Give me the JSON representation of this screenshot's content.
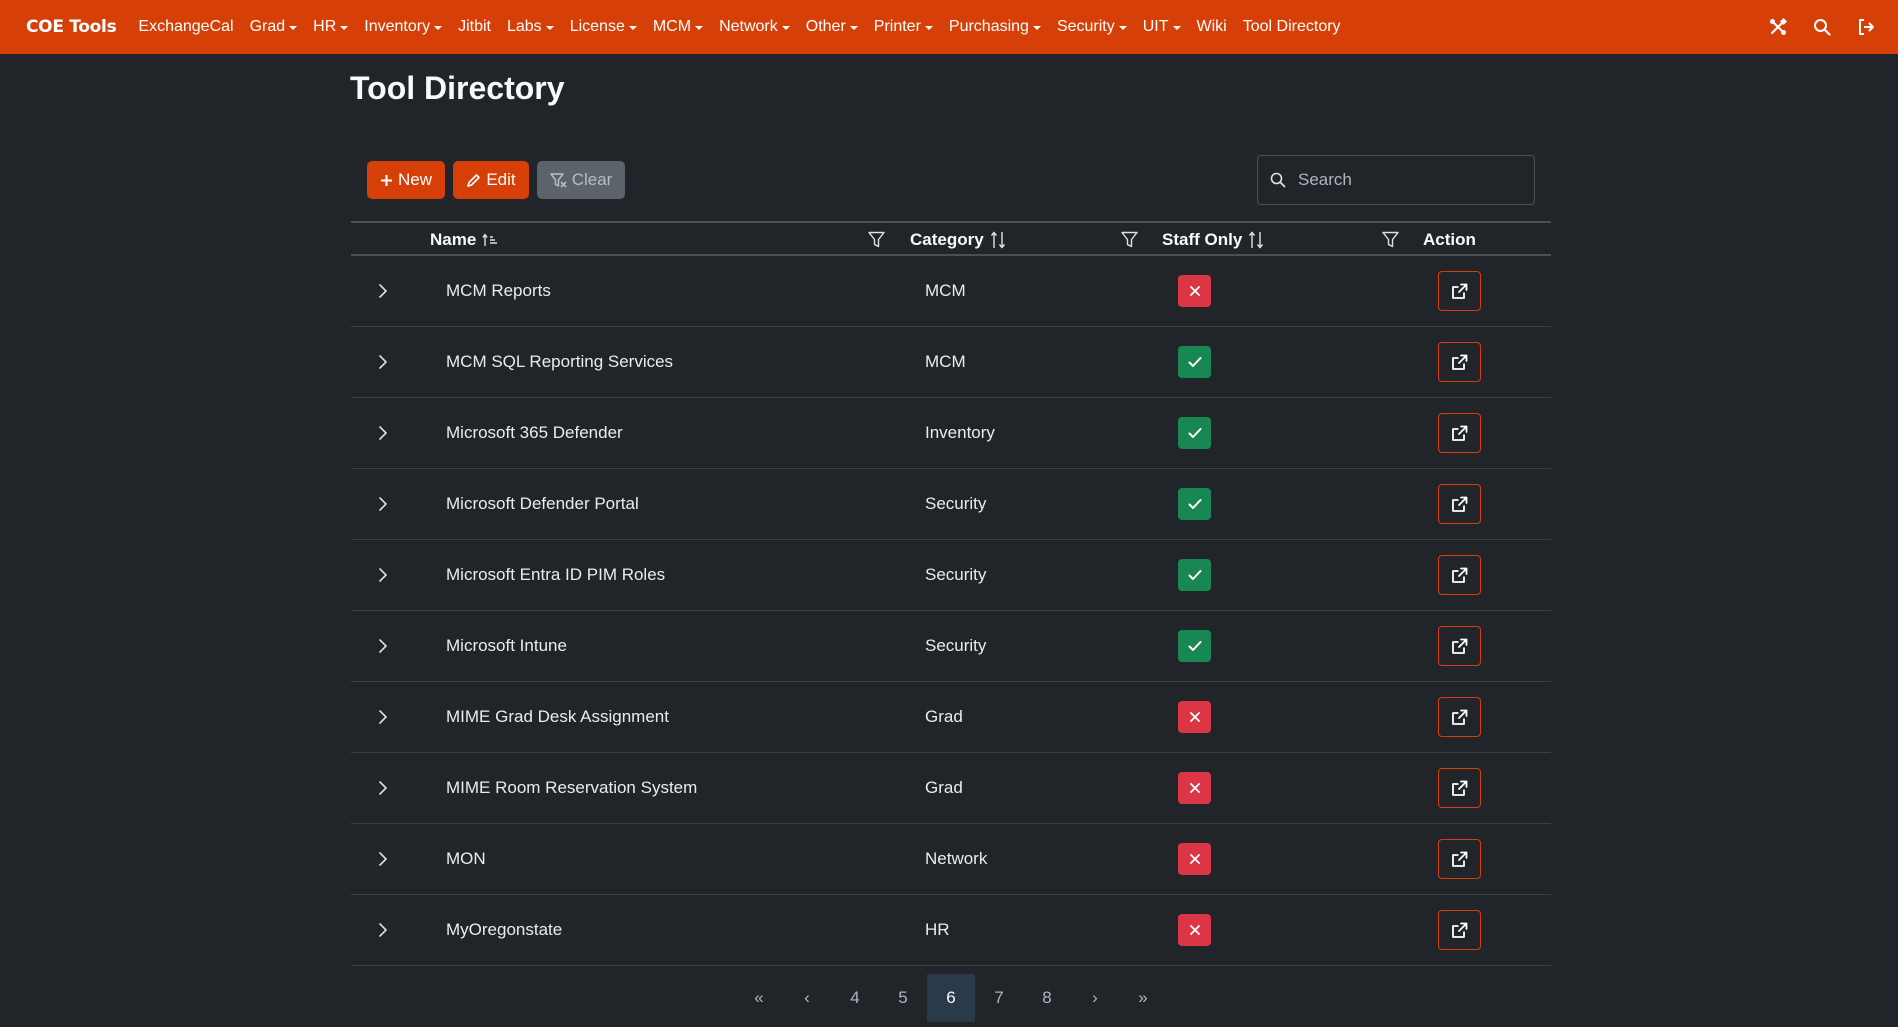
{
  "nav": {
    "brand": "COE Tools",
    "items": [
      {
        "label": "ExchangeCal",
        "dropdown": false
      },
      {
        "label": "Grad",
        "dropdown": true
      },
      {
        "label": "HR",
        "dropdown": true
      },
      {
        "label": "Inventory",
        "dropdown": true
      },
      {
        "label": "Jitbit",
        "dropdown": false
      },
      {
        "label": "Labs",
        "dropdown": true
      },
      {
        "label": "License",
        "dropdown": true
      },
      {
        "label": "MCM",
        "dropdown": true
      },
      {
        "label": "Network",
        "dropdown": true
      },
      {
        "label": "Other",
        "dropdown": true
      },
      {
        "label": "Printer",
        "dropdown": true
      },
      {
        "label": "Purchasing",
        "dropdown": true
      },
      {
        "label": "Security",
        "dropdown": true
      },
      {
        "label": "UIT",
        "dropdown": true
      },
      {
        "label": "Wiki",
        "dropdown": false
      },
      {
        "label": "Tool Directory",
        "dropdown": false
      }
    ],
    "right_icons": [
      "tools-icon",
      "search-icon",
      "sign-out-icon"
    ]
  },
  "page": {
    "title": "Tool Directory"
  },
  "toolbar": {
    "new_label": "New",
    "edit_label": "Edit",
    "clear_label": "Clear"
  },
  "search": {
    "placeholder": "Search",
    "value": ""
  },
  "table": {
    "columns": {
      "name": "Name",
      "category": "Category",
      "staff_only": "Staff Only",
      "action": "Action"
    },
    "rows": [
      {
        "name": "MCM Reports",
        "category": "MCM",
        "staff_only": false
      },
      {
        "name": "MCM SQL Reporting Services",
        "category": "MCM",
        "staff_only": true
      },
      {
        "name": "Microsoft 365 Defender",
        "category": "Inventory",
        "staff_only": true
      },
      {
        "name": "Microsoft Defender Portal",
        "category": "Security",
        "staff_only": true
      },
      {
        "name": "Microsoft Entra ID PIM Roles",
        "category": "Security",
        "staff_only": true
      },
      {
        "name": "Microsoft Intune",
        "category": "Security",
        "staff_only": true
      },
      {
        "name": "MIME Grad Desk Assignment",
        "category": "Grad",
        "staff_only": false
      },
      {
        "name": "MIME Room Reservation System",
        "category": "Grad",
        "staff_only": false
      },
      {
        "name": "MON",
        "category": "Network",
        "staff_only": false
      },
      {
        "name": "MyOregonstate",
        "category": "HR",
        "staff_only": false
      }
    ]
  },
  "pagination": {
    "first": "«",
    "prev": "‹",
    "pages": [
      "4",
      "5",
      "6",
      "7",
      "8"
    ],
    "current": "6",
    "next": "›",
    "last": "»"
  },
  "colors": {
    "brand": "#d73f09",
    "background": "#212529",
    "success": "#198754",
    "danger": "#dc3545"
  }
}
